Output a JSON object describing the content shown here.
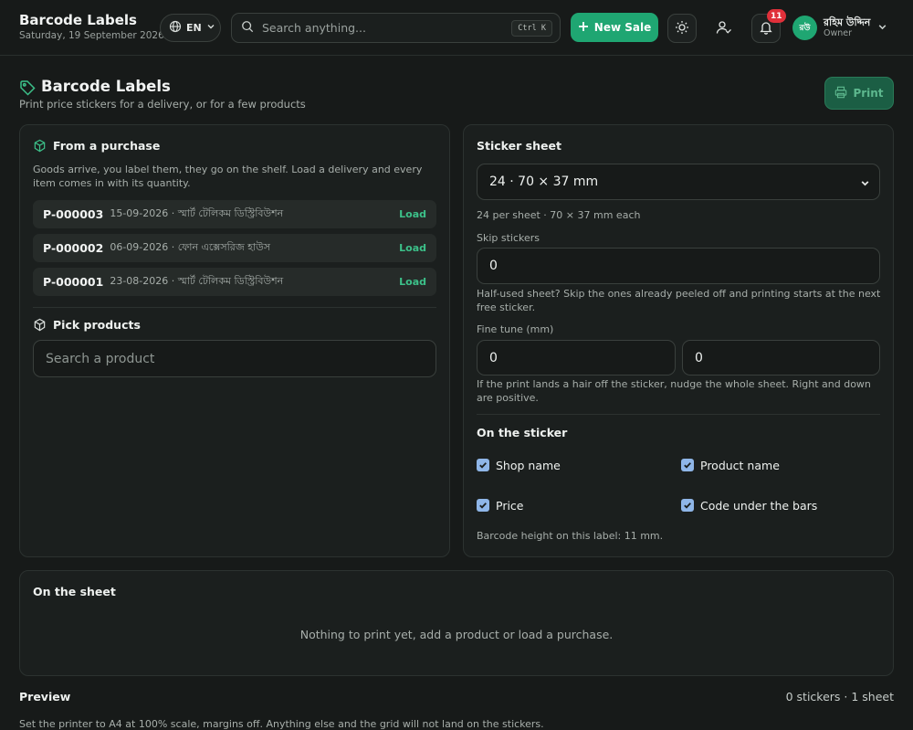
{
  "header": {
    "title": "Barcode Labels",
    "date": "Saturday, 19 September 2026",
    "language": "EN",
    "search_placeholder": "Search anything...",
    "search_shortcut": "Ctrl K",
    "new_sale_label": "New Sale",
    "notifications_count": "11",
    "user": {
      "initials": "রউ",
      "name": "রহিম উদ্দিন",
      "role": "Owner"
    }
  },
  "page": {
    "title": "Barcode Labels",
    "subtitle": "Print price stickers for a delivery, or for a few products",
    "print_label": "Print"
  },
  "from_purchase": {
    "heading": "From a purchase",
    "description": "Goods arrive, you label them, they go on the shelf. Load a delivery and every item comes in with its quantity.",
    "load_label": "Load",
    "purchases": [
      {
        "code": "P-000003",
        "date": "15-09-2026",
        "supplier": "স্মার্ট টেলিকম ডিস্ট্রিবিউশন"
      },
      {
        "code": "P-000002",
        "date": "06-09-2026",
        "supplier": "ফোন এক্সেসরিজ হাউস"
      },
      {
        "code": "P-000001",
        "date": "23-08-2026",
        "supplier": "স্মার্ট টেলিকম ডিস্ট্রিবিউশন"
      }
    ]
  },
  "pick_products": {
    "heading": "Pick products",
    "search_placeholder": "Search a product"
  },
  "sticker_sheet": {
    "heading": "Sticker sheet",
    "selected": "24 · 70 × 37 mm",
    "info": "24 per sheet · 70 × 37 mm each",
    "skip_label": "Skip stickers",
    "skip_value": "0",
    "skip_help": "Half-used sheet? Skip the ones already peeled off and printing starts at the next free sticker.",
    "fine_tune_label": "Fine tune (mm)",
    "fine_tune_x": "0",
    "fine_tune_y": "0",
    "fine_tune_help": "If the print lands a hair off the sticker, nudge the whole sheet. Right and down are positive.",
    "on_sticker_heading": "On the sticker",
    "options": {
      "shop_name": "Shop name",
      "product_name": "Product name",
      "price": "Price",
      "code_under_bars": "Code under the bars"
    },
    "barcode_note": "Barcode height on this label: 11 mm."
  },
  "on_sheet": {
    "heading": "On the sheet",
    "empty_message": "Nothing to print yet, add a product or load a purchase."
  },
  "preview": {
    "heading": "Preview",
    "count": "0 stickers · 1 sheet",
    "note": "Set the printer to A4 at 100% scale, margins off. Anything else and the grid will not land on the stickers."
  },
  "colors": {
    "accent": "#1fa672",
    "badge": "#e0303a",
    "checkbox": "#8fb6e8",
    "background": "#171a19"
  }
}
